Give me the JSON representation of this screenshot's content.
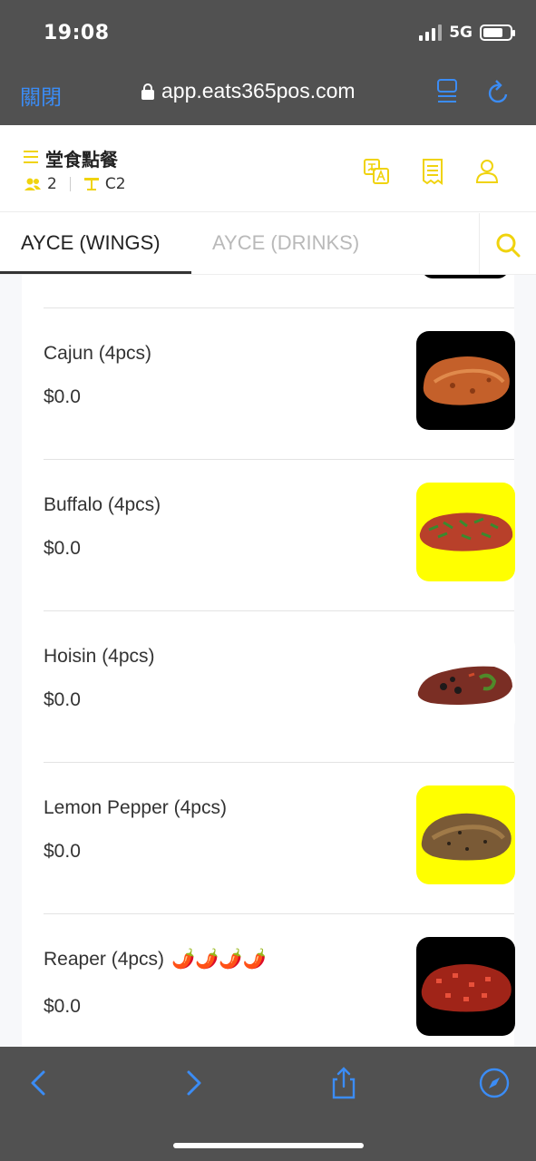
{
  "status_bar": {
    "time": "19:08",
    "network": "5G"
  },
  "browser": {
    "close_label": "關閉",
    "url": "app.eats365pos.com",
    "icons": [
      "lock-icon",
      "tabs-icon",
      "reload-icon"
    ],
    "accent_color": "#3b8cf5"
  },
  "header": {
    "title": "堂食點餐",
    "guests": "2",
    "table": "C2",
    "icons": [
      "menu-icon",
      "translate-icon",
      "receipt-icon",
      "user-icon"
    ],
    "accent_color": "#f0d30e"
  },
  "tabs": {
    "items": [
      {
        "label": "AYCE (WINGS)",
        "active": true
      },
      {
        "label": "AYCE (DRINKS)",
        "active": false
      }
    ],
    "search_icon": "search-icon"
  },
  "menu": {
    "items": [
      {
        "name": "Cajun (4pcs)",
        "price": "$0.0",
        "thumb_bg": "#000000",
        "thumb_icon": "cajun-wing-image"
      },
      {
        "name": "Buffalo (4pcs)",
        "price": "$0.0",
        "thumb_bg": "#ffff00",
        "thumb_icon": "buffalo-wing-image"
      },
      {
        "name": "Hoisin (4pcs)",
        "price": "$0.0",
        "thumb_bg": "#ffffff",
        "thumb_icon": "hoisin-wing-image"
      },
      {
        "name": "Lemon Pepper (4pcs)",
        "price": "$0.0",
        "thumb_bg": "#ffff00",
        "thumb_icon": "lemon-pepper-wing-image"
      },
      {
        "name": "Reaper (4pcs)",
        "price": "$0.0",
        "spice": "🌶️🌶️🌶️🌶️",
        "thumb_bg": "#000000",
        "thumb_icon": "reaper-wing-image"
      }
    ]
  },
  "safari_toolbar": {
    "icons": [
      "back-icon",
      "forward-icon",
      "share-icon",
      "compass-icon"
    ]
  }
}
